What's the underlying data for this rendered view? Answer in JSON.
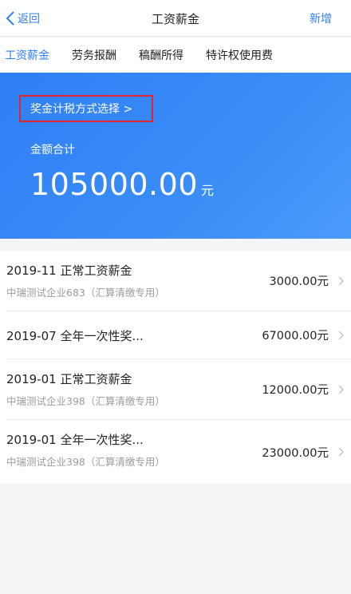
{
  "nav": {
    "back_label": "返回",
    "title": "工资薪金",
    "add_label": "新增"
  },
  "tabs": [
    {
      "label": "工资薪金",
      "active": true
    },
    {
      "label": "劳务报酬",
      "active": false
    },
    {
      "label": "稿酬所得",
      "active": false
    },
    {
      "label": "特许权使用费",
      "active": false
    }
  ],
  "summary": {
    "bonus_method_label": "奖金计税方式选择 >",
    "total_label": "金额合计",
    "total_value": "105000.00",
    "total_unit": "元"
  },
  "records": [
    {
      "title": "2019-11 正常工资薪金",
      "subtitle": "中瑞测试企业683（汇算清缴专用）",
      "amount": "3000.00元"
    },
    {
      "title": "2019-07 全年一次性奖...",
      "subtitle": "",
      "amount": "67000.00元"
    },
    {
      "title": "2019-01 正常工资薪金",
      "subtitle": "中瑞测试企业398（汇算清缴专用）",
      "amount": "12000.00元"
    },
    {
      "title": "2019-01 全年一次性奖...",
      "subtitle": "中瑞测试企业398（汇算清缴专用）",
      "amount": "23000.00元"
    }
  ],
  "icons": {
    "back": "chevron-left-icon",
    "row_arrow": "chevron-right-icon"
  },
  "colors": {
    "accent": "#2f7ff5",
    "highlight_border": "#e0232d",
    "secondary_text": "#9a9ca1"
  }
}
